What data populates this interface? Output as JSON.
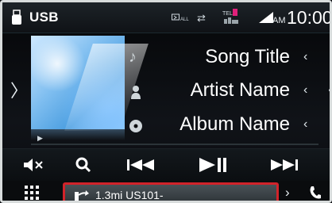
{
  "status_bar": {
    "source": "USB",
    "ampm": "AM",
    "time": "10:00",
    "tel_label": "TEL",
    "icons": [
      "usb-icon",
      "bluetooth-audio-icon",
      "shuffle-icon",
      "phone-status-icon",
      "signal-strength-icon"
    ]
  },
  "track": {
    "title": "Song Title",
    "artist": "Artist Name",
    "album": "Album Name"
  },
  "controls": {
    "icons": [
      "mute-icon",
      "search-icon",
      "previous-track-icon",
      "play-pause-icon",
      "next-track-icon"
    ]
  },
  "bottom_bar": {
    "nav_info": "1.3mi US101-",
    "icons": [
      "menu-grid-icon",
      "turn-direction-icon",
      "chevron-right-icon",
      "phone-icon"
    ]
  },
  "colors": {
    "highlight": "#d2232a",
    "background": "#0b0d10",
    "album_blue": "#4b9ee0"
  }
}
